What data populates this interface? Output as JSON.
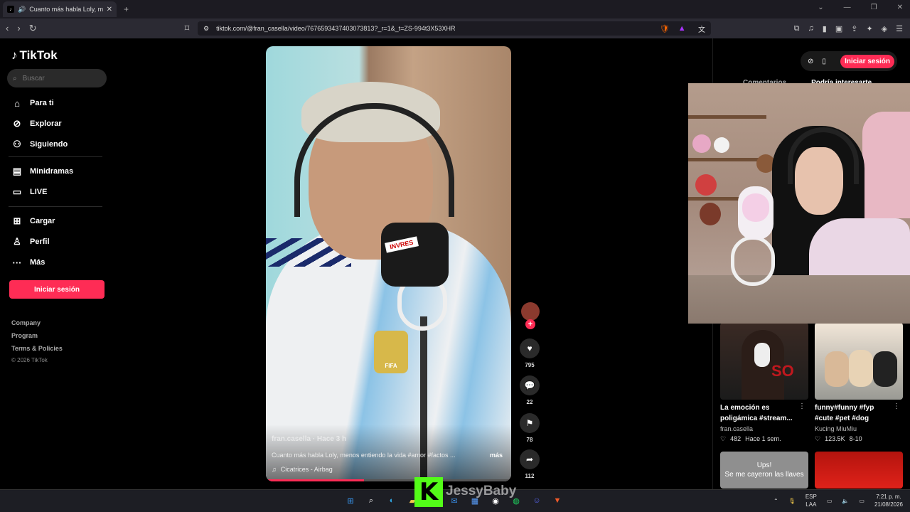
{
  "browser": {
    "tab_title": "Cuanto más habla Loly, menos entiendo la vida",
    "url": "tiktok.com/@fran_casella/video/7676593437403073813?_r=1&_t=ZS-994t3X53XHR"
  },
  "sidebar": {
    "logo": "TikTok",
    "search_placeholder": "Buscar",
    "nav": [
      {
        "label": "Para ti",
        "icon": "home-icon"
      },
      {
        "label": "Explorar",
        "icon": "compass-icon"
      },
      {
        "label": "Siguiendo",
        "icon": "following-icon"
      },
      {
        "label": "Minidramas",
        "icon": "minidramas-icon"
      },
      {
        "label": "LIVE",
        "icon": "live-icon"
      },
      {
        "label": "Cargar",
        "icon": "upload-icon"
      },
      {
        "label": "Perfil",
        "icon": "profile-icon"
      },
      {
        "label": "Más",
        "icon": "more-icon"
      }
    ],
    "login_label": "Iniciar sesión",
    "footer": [
      "Company",
      "Program",
      "Terms & Policies"
    ],
    "copyright": "© 2026 TikTok"
  },
  "video": {
    "author_line": "fran.casella · Hace 3 h",
    "mic_label": "INVRES",
    "badge_label": "FIFA",
    "description": "Cuanto más habla Loly, menos entiendo la vida #amor #factos ...",
    "more_label": "más",
    "music": "Cicatrices - Airbag",
    "progress": 0.4
  },
  "actions": {
    "likes": "795",
    "comments": "22",
    "saves": "78",
    "shares": "112"
  },
  "right_panel": {
    "login_label": "Iniciar sesión",
    "tabs": [
      "Comentarios",
      "Podría interesarte"
    ],
    "cards": [
      {
        "title": "La emoción es poligámica #stream...",
        "author": "fran.casella",
        "likes": "482",
        "date": "Hace 1 sem."
      },
      {
        "title": "funny#funny #fyp #cute #pet #dog",
        "author": "Kucing MiuMiu",
        "likes": "123.5K",
        "date": "8-10"
      }
    ],
    "bottom_card_text": "Ups!\nSe me cayeron las llaves"
  },
  "taskbar": {
    "lang": "ESP",
    "region": "LAA",
    "time": "7:21 p. m.",
    "date": "21/08/2026",
    "streamer": "JessyBaby",
    "kick_letter": "K"
  },
  "colors": {
    "accent": "#fe2c55",
    "kick": "#53fc18"
  }
}
